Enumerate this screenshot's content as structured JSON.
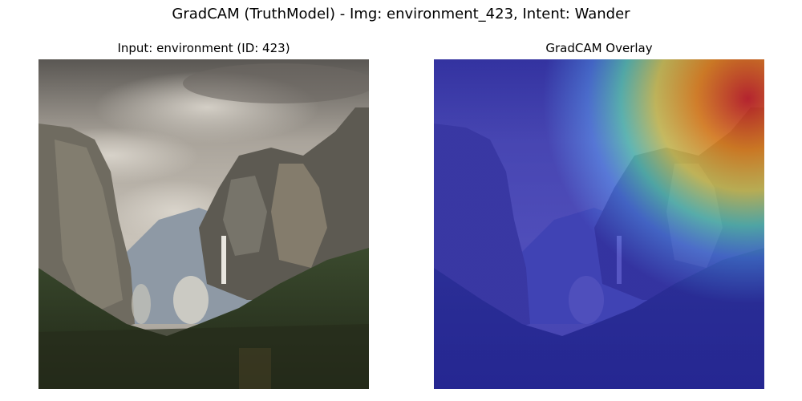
{
  "figure": {
    "suptitle": "GradCAM (TruthModel) - Img: environment_423, Intent: Wander"
  },
  "panels": [
    {
      "title": "Input: environment (ID: 423)"
    },
    {
      "title": "GradCAM Overlay"
    }
  ]
}
